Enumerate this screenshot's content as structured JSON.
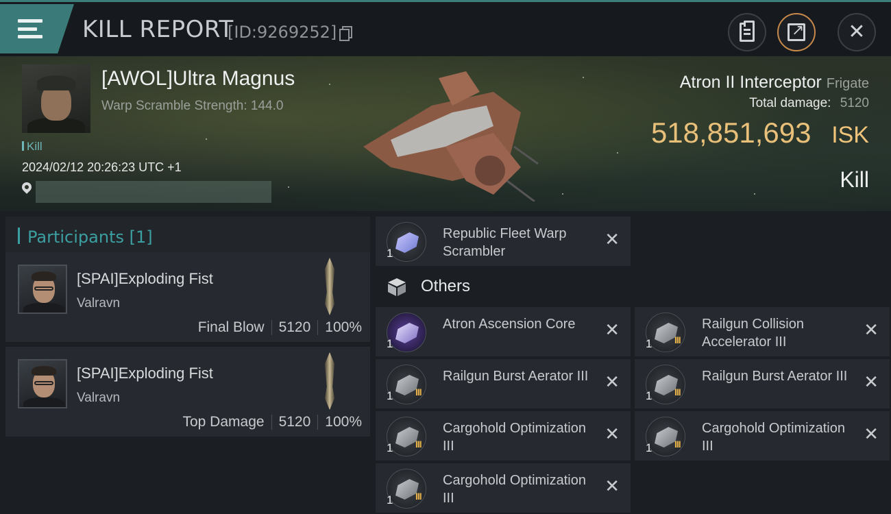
{
  "header": {
    "title": "KILL REPORT",
    "report_id": "[ID:9269252]",
    "accent_color": "#3a7a78"
  },
  "victim": {
    "name": "[AWOL]Ultra Magnus",
    "warp_scramble": "Warp Scramble Strength: 144.0",
    "kill_tag": "Kill",
    "timestamp": "2024/02/12 20:26:23 UTC +1",
    "ship_name": "Atron II Interceptor",
    "ship_class": "Frigate",
    "total_damage_label": "Total damage:",
    "total_damage_value": "5120",
    "isk_value": "518,851,693",
    "isk_unit": "ISK",
    "result_label": "Kill",
    "isk_color": "#e9c07a"
  },
  "participants": {
    "header": "Participants [1]",
    "rows": [
      {
        "name": "[SPAI]Exploding Fist",
        "ship": "Valravn",
        "role": "Final Blow",
        "damage": "5120",
        "percent": "100%"
      },
      {
        "name": "[SPAI]Exploding Fist",
        "ship": "Valravn",
        "role": "Top Damage",
        "damage": "5120",
        "percent": "100%"
      }
    ]
  },
  "items": {
    "fitted": [
      {
        "name": "Republic Fleet Warp Scrambler",
        "qty": "1",
        "tier": ""
      }
    ],
    "others_label": "Others",
    "others": [
      {
        "name": "Atron Ascension Core",
        "qty": "1",
        "tier": ""
      },
      {
        "name": "Railgun Collision Accelerator III",
        "qty": "1",
        "tier": "III"
      },
      {
        "name": "Railgun Burst Aerator III",
        "qty": "1",
        "tier": "III"
      },
      {
        "name": "Railgun Burst Aerator III",
        "qty": "1",
        "tier": "III"
      },
      {
        "name": "Cargohold Optimization III",
        "qty": "1",
        "tier": "III"
      },
      {
        "name": "Cargohold Optimization III",
        "qty": "1",
        "tier": "III"
      },
      {
        "name": "Cargohold Optimization III",
        "qty": "1",
        "tier": "III"
      }
    ]
  },
  "icons": {
    "menu": "menu-icon",
    "copy": "copy-icon",
    "clipboard": "clipboard-icon",
    "share": "share-icon",
    "close": "close-icon",
    "location": "location-pin-icon",
    "others": "cube-icon",
    "remove": "x-icon"
  }
}
